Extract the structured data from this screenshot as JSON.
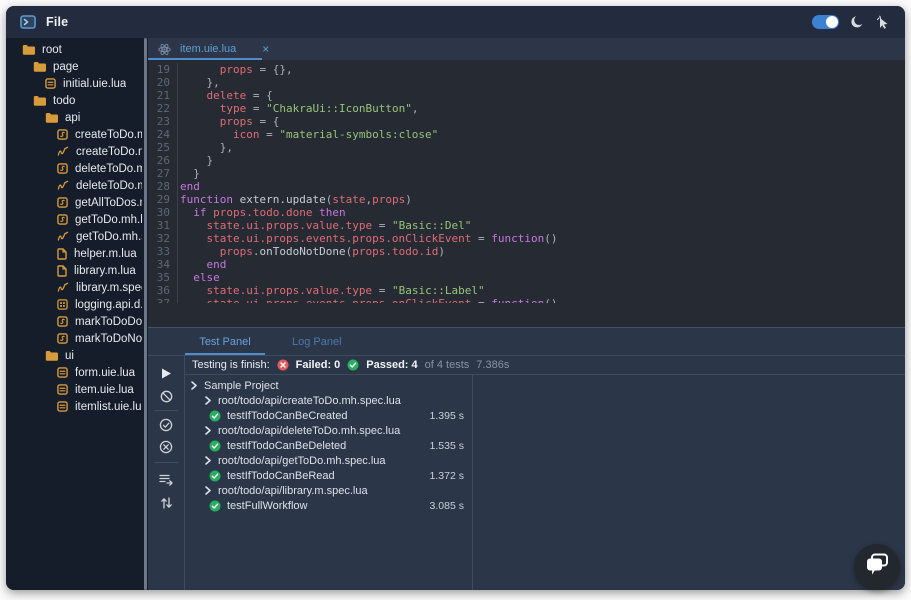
{
  "header": {
    "file_menu": "File",
    "theme_toggle_on": true
  },
  "colors": {
    "accent_blue": "#4f8cc9",
    "toggle_blue": "#3b82d0",
    "pass_green": "#27ae60",
    "fail_red": "#e05c5c",
    "folder_amber": "#d89b3b",
    "syntax_keyword": "#c678dd",
    "syntax_identifier": "#e06c75",
    "syntax_string": "#98c379"
  },
  "sidebar": {
    "tree": [
      {
        "label": "root",
        "icon": "folder",
        "level": 1
      },
      {
        "label": "page",
        "icon": "folder",
        "level": 2
      },
      {
        "label": "initial.uie.lua",
        "icon": "uie",
        "level": 3
      },
      {
        "label": "todo",
        "icon": "folder",
        "level": 2
      },
      {
        "label": "api",
        "icon": "folder",
        "level": 3
      },
      {
        "label": "createToDo.mh",
        "icon": "lua",
        "level": 4
      },
      {
        "label": "createToDo.mh",
        "icon": "spec",
        "level": 4
      },
      {
        "label": "deleteToDo.mh",
        "icon": "lua",
        "level": 4
      },
      {
        "label": "deleteToDo.mh",
        "icon": "spec",
        "level": 4
      },
      {
        "label": "getAllToDos.m",
        "icon": "lua",
        "level": 4
      },
      {
        "label": "getToDo.mh.lu",
        "icon": "lua",
        "level": 4
      },
      {
        "label": "getToDo.mh.sp",
        "icon": "spec",
        "level": 4
      },
      {
        "label": "helper.m.lua",
        "icon": "doc",
        "level": 4
      },
      {
        "label": "library.m.lua",
        "icon": "doc",
        "level": 4
      },
      {
        "label": "library.m.spec",
        "icon": "spec",
        "level": 4
      },
      {
        "label": "logging.api.d.l",
        "icon": "grid",
        "level": 4
      },
      {
        "label": "markToDoDon",
        "icon": "lua",
        "level": 4
      },
      {
        "label": "markToDoNotl",
        "icon": "lua",
        "level": 4
      },
      {
        "label": "ui",
        "icon": "folder",
        "level": 3
      },
      {
        "label": "form.uie.lua",
        "icon": "uie",
        "level": 4
      },
      {
        "label": "item.uie.lua",
        "icon": "uie",
        "level": 4
      },
      {
        "label": "itemlist.uie.lua",
        "icon": "uie",
        "level": 4
      }
    ]
  },
  "editor": {
    "tab_label": "item.uie.lua",
    "tab_close": "×",
    "lines": [
      {
        "n": 19,
        "indent": 6,
        "tokens": [
          [
            "id",
            "props"
          ],
          [
            "pun",
            " = {},"
          ]
        ]
      },
      {
        "n": 20,
        "indent": 4,
        "tokens": [
          [
            "pun",
            "},"
          ]
        ]
      },
      {
        "n": 21,
        "indent": 4,
        "tokens": [
          [
            "id",
            "delete"
          ],
          [
            "pun",
            " = {"
          ]
        ]
      },
      {
        "n": 22,
        "indent": 6,
        "tokens": [
          [
            "id",
            "type"
          ],
          [
            "pun",
            " = "
          ],
          [
            "str",
            "\"ChakraUi::IconButton\""
          ],
          [
            "pun",
            ","
          ]
        ]
      },
      {
        "n": 23,
        "indent": 6,
        "tokens": [
          [
            "id",
            "props"
          ],
          [
            "pun",
            " = {"
          ]
        ]
      },
      {
        "n": 24,
        "indent": 8,
        "tokens": [
          [
            "id",
            "icon"
          ],
          [
            "pun",
            " = "
          ],
          [
            "str",
            "\"material-symbols:close\""
          ]
        ]
      },
      {
        "n": 25,
        "indent": 6,
        "tokens": [
          [
            "pun",
            "},"
          ]
        ]
      },
      {
        "n": 26,
        "indent": 4,
        "tokens": [
          [
            "pun",
            "}"
          ]
        ]
      },
      {
        "n": 27,
        "indent": 2,
        "tokens": [
          [
            "pun",
            "}"
          ]
        ]
      },
      {
        "n": 28,
        "indent": 0,
        "tokens": [
          [
            "kw",
            "end"
          ]
        ]
      },
      {
        "n": 29,
        "indent": 0,
        "tokens": [
          [
            "kw",
            "function"
          ],
          [
            "fn",
            " extern.update"
          ],
          [
            "pun",
            "("
          ],
          [
            "id",
            "state"
          ],
          [
            "pun",
            ","
          ],
          [
            "id",
            "props"
          ],
          [
            "pun",
            ")"
          ]
        ]
      },
      {
        "n": 30,
        "indent": 2,
        "tokens": [
          [
            "kw",
            "if"
          ],
          [
            "id",
            " props.todo.done"
          ],
          [
            "kw",
            " then"
          ]
        ]
      },
      {
        "n": 31,
        "indent": 4,
        "tokens": [
          [
            "id",
            "state.ui.props.value.type"
          ],
          [
            "pun",
            " = "
          ],
          [
            "str",
            "\"Basic::Del\""
          ]
        ]
      },
      {
        "n": 32,
        "indent": 4,
        "tokens": [
          [
            "id",
            "state.ui.props.events.props.onClickEvent"
          ],
          [
            "pun",
            " = "
          ],
          [
            "kw",
            "function"
          ],
          [
            "pun",
            "()"
          ]
        ]
      },
      {
        "n": 33,
        "indent": 6,
        "tokens": [
          [
            "id",
            "props"
          ],
          [
            "pun",
            "."
          ],
          [
            "fn",
            "onTodoNotDone"
          ],
          [
            "pun",
            "("
          ],
          [
            "id",
            "props.todo.id"
          ],
          [
            "pun",
            ")"
          ]
        ]
      },
      {
        "n": 34,
        "indent": 4,
        "tokens": [
          [
            "kw",
            "end"
          ]
        ]
      },
      {
        "n": 35,
        "indent": 2,
        "tokens": [
          [
            "kw",
            "else"
          ]
        ]
      },
      {
        "n": 36,
        "indent": 4,
        "tokens": [
          [
            "id",
            "state.ui.props.value.type"
          ],
          [
            "pun",
            " = "
          ],
          [
            "str",
            "\"Basic::Label\""
          ]
        ]
      },
      {
        "n": 37,
        "indent": 4,
        "tokens": [
          [
            "id",
            "state.ui.props.events.props.onClickEvent"
          ],
          [
            "pun",
            " = "
          ],
          [
            "kw",
            "function"
          ],
          [
            "pun",
            "()"
          ]
        ]
      }
    ]
  },
  "panel": {
    "tabs": [
      {
        "label": "Test Panel",
        "active": true
      },
      {
        "label": "Log Panel",
        "active": false
      }
    ],
    "status": {
      "label": "Testing is finish:",
      "failed": "Failed: 0",
      "passed": "Passed: 4",
      "of": "of 4 tests",
      "time": "7.386s"
    },
    "toolbar": [
      "play",
      "ban",
      "divider",
      "check-circle",
      "x-circle",
      "divider",
      "playlist-add",
      "sort"
    ],
    "results": [
      {
        "type": "suite",
        "label": "Sample Project"
      },
      {
        "type": "file",
        "label": "root/todo/api/createToDo.mh.spec.lua"
      },
      {
        "type": "test",
        "label": "testIfTodoCanBeCreated",
        "duration": "1.395 s"
      },
      {
        "type": "file",
        "label": "root/todo/api/deleteToDo.mh.spec.lua"
      },
      {
        "type": "test",
        "label": "testIfTodoCanBeDeleted",
        "duration": "1.535 s"
      },
      {
        "type": "file",
        "label": "root/todo/api/getToDo.mh.spec.lua"
      },
      {
        "type": "test",
        "label": "testIfTodoCanBeRead",
        "duration": "1.372 s"
      },
      {
        "type": "file",
        "label": "root/todo/api/library.m.spec.lua"
      },
      {
        "type": "test",
        "label": "testFullWorkflow",
        "duration": "3.085 s"
      }
    ]
  }
}
